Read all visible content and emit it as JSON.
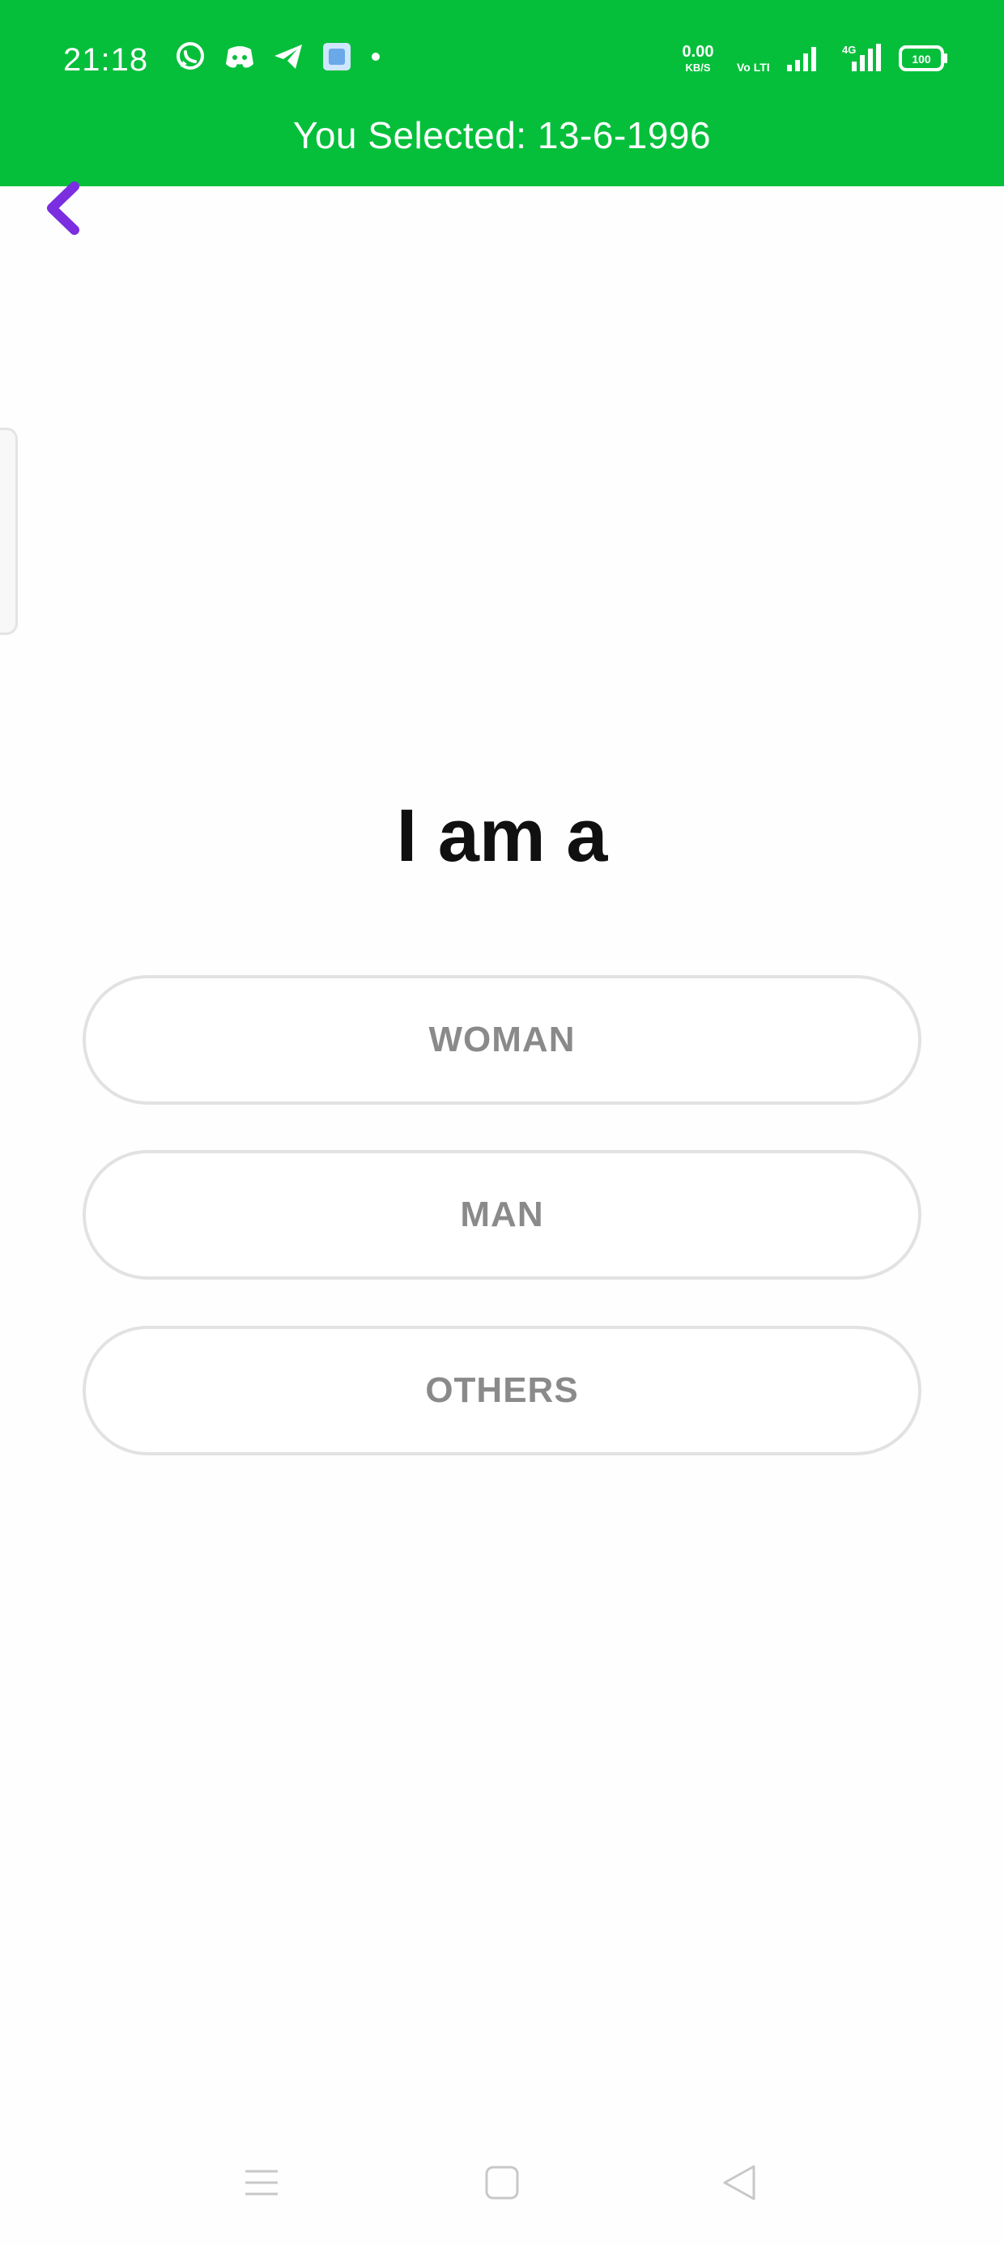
{
  "status_bar": {
    "time": "21:18",
    "left_icons": [
      "whatsapp-icon",
      "discord-icon",
      "telegram-icon",
      "app-icon",
      "dot-icon"
    ],
    "right_icons": [
      "network-speed-icon",
      "volte-icon",
      "signal-icon",
      "signal-4g-icon",
      "battery-icon"
    ],
    "network_speed": "0.00",
    "network_speed_unit": "KB/S",
    "volte_label": "Vo LTE",
    "network_type": "4G",
    "battery_level": "100",
    "background_color": "#05bf3a"
  },
  "banner": {
    "text": "You Selected: 13-6-1996"
  },
  "back_button": {
    "icon": "chevron-left-icon",
    "color": "#7a2ee0"
  },
  "main": {
    "title": "I am a",
    "options": [
      {
        "label": "WOMAN"
      },
      {
        "label": "MAN"
      },
      {
        "label": "OTHERS"
      }
    ]
  },
  "nav_bar": {
    "items": [
      "menu-icon",
      "home-icon",
      "back-icon"
    ]
  }
}
